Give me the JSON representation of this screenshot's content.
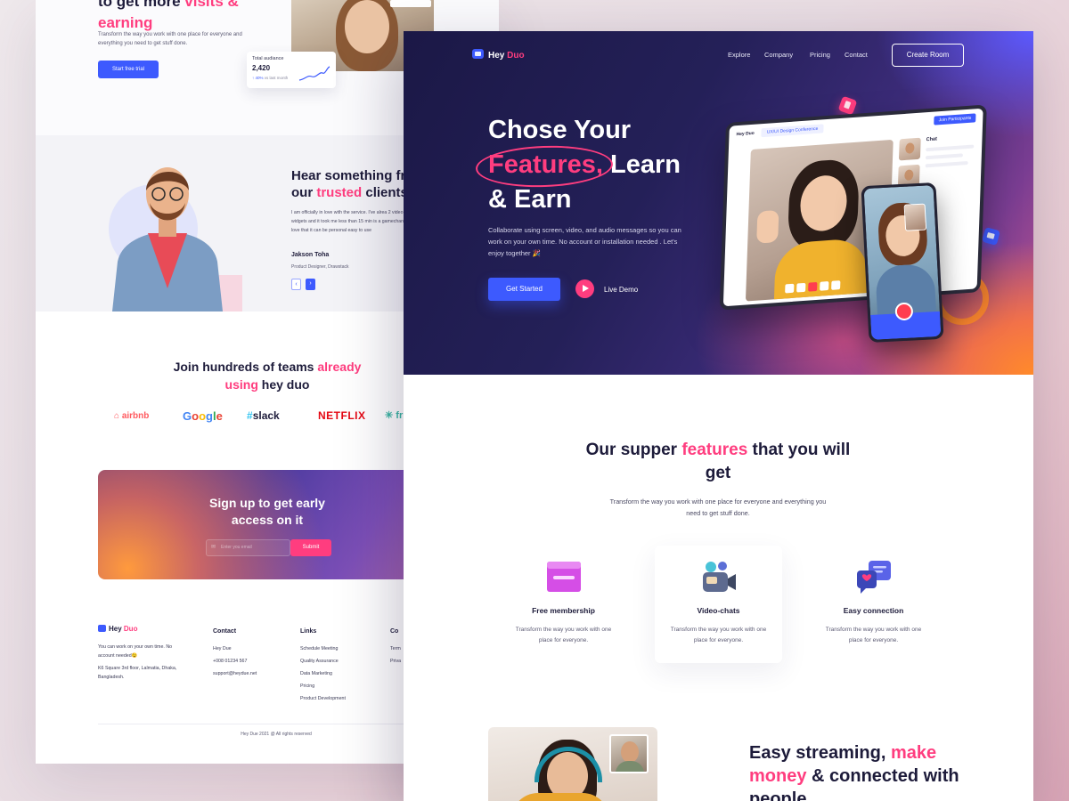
{
  "back": {
    "hero": {
      "title_a": "to get more ",
      "title_b": "visits &",
      "title_c": "earning",
      "text": "Transform the way you work with one place for everyone and everything you need to get stuff done.",
      "cta": "Start free trial",
      "stat_label": "Total audiance",
      "stat_value": "2,420",
      "stat_growth": "40%",
      "stat_growth_suffix": "vs last month"
    },
    "testimonial": {
      "title_a": "Hear something fr",
      "title_b": "our ",
      "title_c": "trusted",
      "title_d": " clients",
      "quote": "I am officially in love with the service. I've alrea 2 video widgets and it took me less than 15 min is a gamechanger. I love that it can be personal easy to use",
      "name": "Jakson Toha",
      "role": "Product Designer, Drawstack",
      "prev": "‹",
      "next": "›"
    },
    "join": {
      "title_a": "Join hundreds of teams ",
      "title_b": "already",
      "title_c": "using",
      "title_d": " hey duo"
    },
    "logos": {
      "airbnb": "airbnb",
      "google": [
        "G",
        "o",
        "o",
        "g",
        "l",
        "e"
      ],
      "slack": "slack",
      "netflix": "NETFLIX",
      "other": "fr"
    },
    "signup": {
      "title": "Sign up to get early access on it",
      "placeholder": "Enter you email",
      "submit": "Submit"
    },
    "footer": {
      "logo_a": "Hey ",
      "logo_b": "Duo",
      "about": "You can work on your own time. No account needed😉",
      "address": "K6 Square 3rd floor, Lalmatia, Dhaka, Bangladesh.",
      "contact_title": "Contact",
      "contact_items": [
        "Hey Due",
        "+008 01234 567",
        "support@heydue.net"
      ],
      "links_title": "Links",
      "links_items": [
        "Schedule Meeting",
        "Quality Assurance",
        "Data Marketing",
        "Pricing",
        "Product Development"
      ],
      "company_title": "Co",
      "company_items": [
        "Term",
        "Priva"
      ],
      "copyright": "Hey Due 2021 @ All rights reserved"
    }
  },
  "front": {
    "nav": {
      "logo_a": "Hey ",
      "logo_b": "Duo",
      "links": [
        "Explore",
        "Company",
        "Pricing",
        "Contact"
      ],
      "create_room": "Create Room"
    },
    "hero": {
      "line1": "Chose Your",
      "highlight": "Features,",
      "line2_rest": " Learn",
      "line3": "& Earn",
      "subtitle": "Collaborate using screen, video, and audio messages so you can work on your own time. No account or installation needed . Let's enjoy together 🎉",
      "cta": "Get Started",
      "demo": "Live Demo"
    },
    "tablet": {
      "logo": "Hey Duo",
      "meeting": "UX/UI Design Conference",
      "join": "Join Participants",
      "chat": "Chat"
    },
    "features": {
      "title_a": "Our supper ",
      "title_b": "features",
      "title_c": " that you will get",
      "subtitle": "Transform the way you work with one place for everyone and everything you need to get stuff done.",
      "items": [
        {
          "name": "Free membership",
          "desc": "Transform the way you work with one place for everyone.",
          "icon": "card-icon"
        },
        {
          "name": "Video-chats",
          "desc": "Transform the way you work with one place for everyone.",
          "icon": "video-camera-icon"
        },
        {
          "name": "Easy connection",
          "desc": "Transform the way you work with one place for everyone.",
          "icon": "chat-bubbles-icon"
        }
      ]
    },
    "streaming": {
      "title_a": "Easy streaming, ",
      "title_b": "make money",
      "title_c": " & connected with people"
    }
  },
  "colors": {
    "brand_blue": "#3d5afe",
    "accent_pink": "#ff3d7f",
    "dark_text": "#1d1b3a",
    "hero_orange": "#ff8a2a"
  }
}
